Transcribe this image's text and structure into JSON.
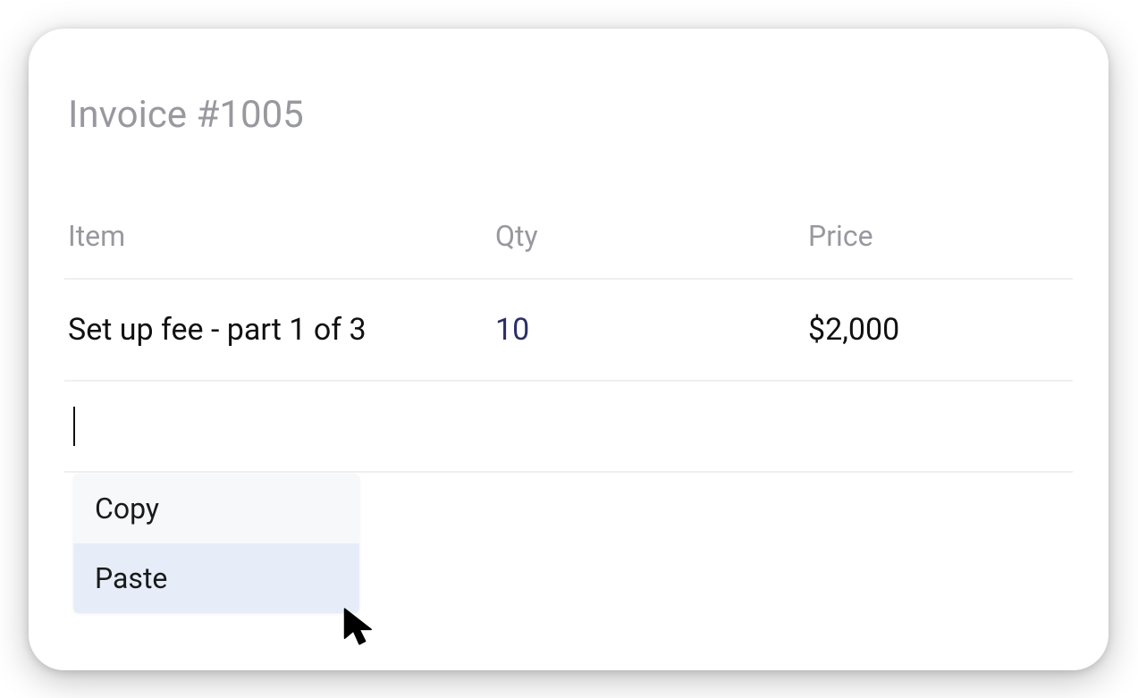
{
  "invoice": {
    "title": "Invoice #1005",
    "columns": {
      "item": "Item",
      "qty": "Qty",
      "price": "Price"
    },
    "rows": [
      {
        "item": "Set up fee - part 1 of 3",
        "qty": "10",
        "price": "$2,000"
      }
    ],
    "editing": {
      "value": ""
    }
  },
  "context_menu": {
    "items": [
      {
        "label": "Copy",
        "highlighted": false
      },
      {
        "label": "Paste",
        "highlighted": true
      }
    ]
  }
}
